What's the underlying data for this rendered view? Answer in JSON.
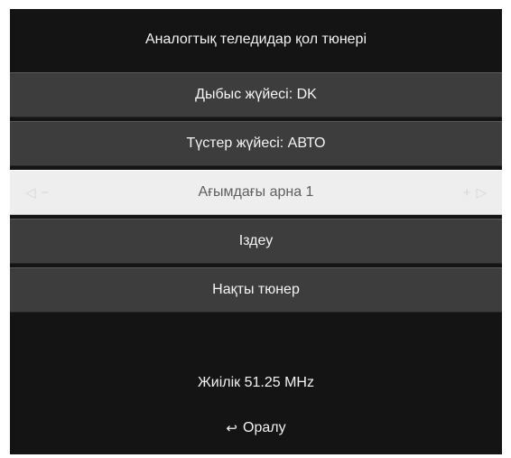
{
  "header": {
    "title": "Аналогтық теледидар қол тюнері"
  },
  "menu": {
    "items": [
      {
        "label": "Дыбыс жүйесі: DK"
      },
      {
        "label": "Түстер жүйесі: АВТО"
      },
      {
        "label": "Ағымдағы арна 1",
        "left_arrow": "◁",
        "minus": "−",
        "plus": "+",
        "right_arrow": "▷"
      },
      {
        "label": "Іздеу"
      },
      {
        "label": "Нақты тюнер"
      }
    ]
  },
  "info": {
    "frequency": "Жиілік 51.25 MHz"
  },
  "footer": {
    "back_icon": "↩",
    "back_label": "Оралу"
  },
  "colors": {
    "background": "#141414",
    "row": "#3d3d3d",
    "selected_row": "#eeeeee"
  }
}
